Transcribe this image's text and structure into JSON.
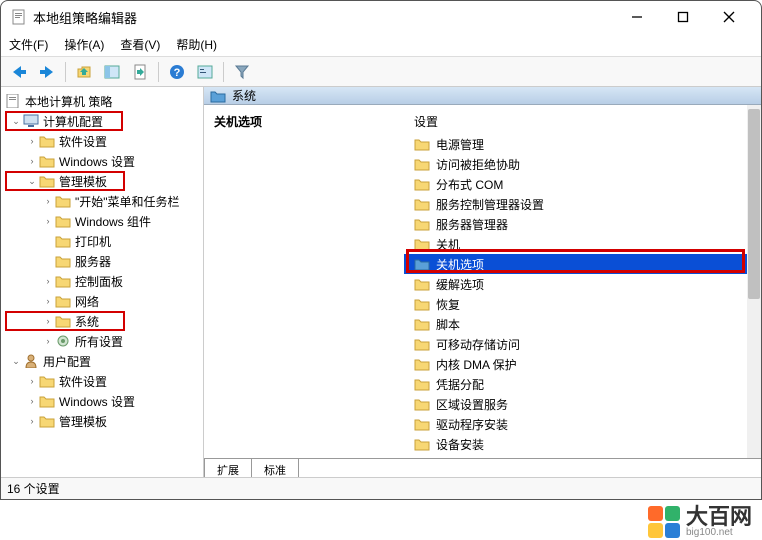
{
  "window": {
    "title": "本地组策略编辑器"
  },
  "menubar": {
    "file": "文件(F)",
    "action": "操作(A)",
    "view": "查看(V)",
    "help": "帮助(H)"
  },
  "tree": {
    "root": "本地计算机 策略",
    "computer_config": "计算机配置",
    "software_settings": "软件设置",
    "windows_settings": "Windows 设置",
    "admin_templates": "管理模板",
    "start_menu_taskbar": "\"开始\"菜单和任务栏",
    "windows_components": "Windows 组件",
    "printers": "打印机",
    "server": "服务器",
    "control_panel": "控制面板",
    "network": "网络",
    "system": "系统",
    "all_settings": "所有设置",
    "user_config": "用户配置",
    "software_settings2": "软件设置",
    "windows_settings2": "Windows 设置",
    "admin_templates2": "管理模板"
  },
  "pathbar": {
    "label": "系统"
  },
  "left_column": {
    "title": "关机选项"
  },
  "right_column": {
    "header": "设置",
    "items": [
      "电源管理",
      "访问被拒绝协助",
      "分布式 COM",
      "服务控制管理器设置",
      "服务器管理器",
      "关机",
      "关机选项",
      "缓解选项",
      "恢复",
      "脚本",
      "可移动存储访问",
      "内核 DMA 保护",
      "凭据分配",
      "区域设置服务",
      "驱动程序安装",
      "设备安装"
    ],
    "selected_index": 6
  },
  "tabs": {
    "extended": "扩展",
    "standard": "标准"
  },
  "statusbar": {
    "text": "16 个设置"
  },
  "watermark": {
    "name": "大百网",
    "url": "big100.net"
  }
}
